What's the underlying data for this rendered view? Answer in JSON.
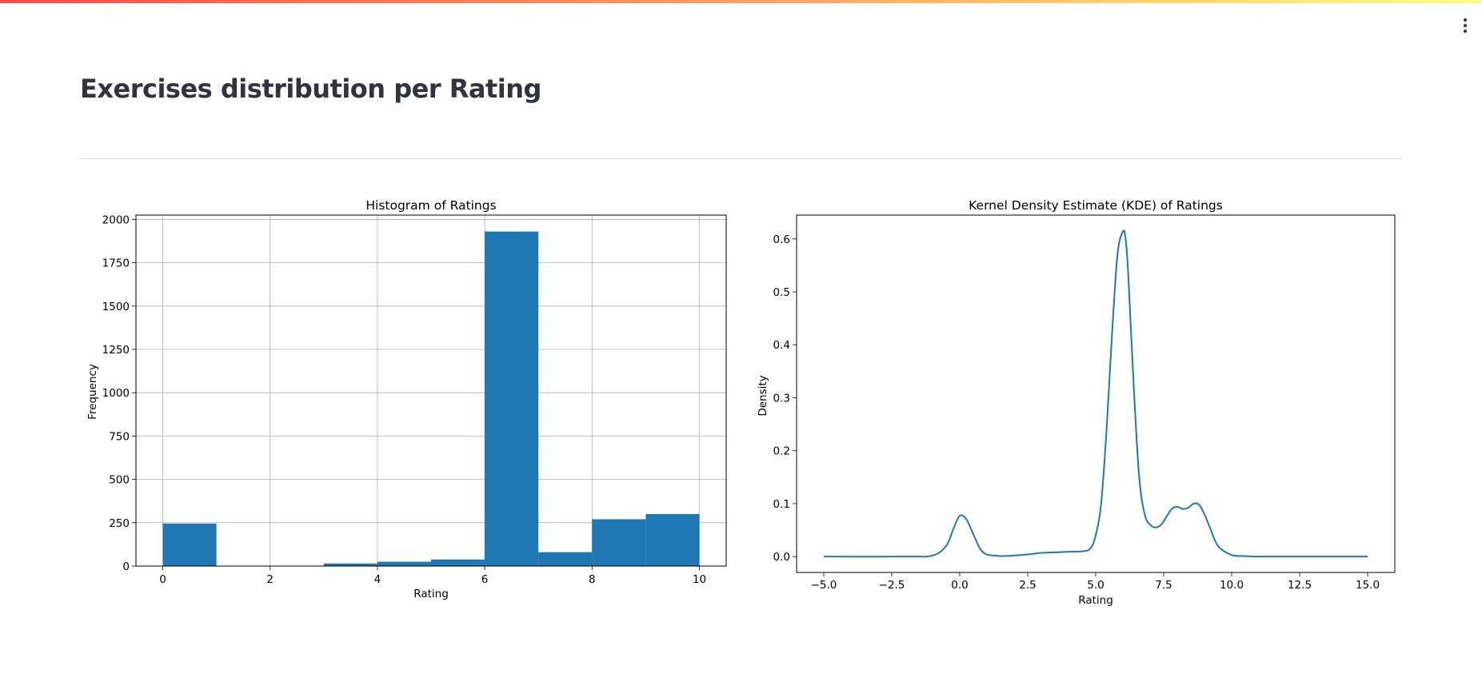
{
  "page": {
    "title": "Exercises distribution per Rating",
    "menu_icon": "vertical-ellipsis-icon",
    "colors": {
      "accent_gradient": [
        "#ff4b4b",
        "#ff9e66",
        "#fffd80"
      ],
      "title": "#31333f",
      "bar": "#1f77b4",
      "line": "#1f77b4"
    }
  },
  "chart_data": [
    {
      "type": "bar",
      "title": "Histogram of Ratings",
      "xlabel": "Rating",
      "ylabel": "Frequency",
      "grid": true,
      "bin_edges": [
        0,
        1,
        2,
        3,
        4,
        5,
        6,
        7,
        8,
        9,
        10
      ],
      "values": [
        245,
        0,
        0,
        15,
        25,
        38,
        1930,
        80,
        270,
        300
      ],
      "xlim": [
        -0.5,
        10.5
      ],
      "ylim": [
        0,
        2025
      ],
      "xticks": [
        "0",
        "2",
        "4",
        "6",
        "8",
        "10"
      ],
      "yticks": [
        "0",
        "250",
        "500",
        "750",
        "1000",
        "1250",
        "1500",
        "1750",
        "2000"
      ]
    },
    {
      "type": "line",
      "title": "Kernel Density Estimate (KDE) of Ratings",
      "xlabel": "Rating",
      "ylabel": "Density",
      "grid": false,
      "x": [
        -5.0,
        -2.0,
        -1.0,
        -0.5,
        -0.25,
        0.0,
        0.25,
        0.5,
        0.75,
        1.0,
        1.5,
        2.0,
        2.5,
        3.0,
        3.5,
        4.0,
        4.5,
        4.8,
        5.0,
        5.2,
        5.4,
        5.6,
        5.8,
        6.0,
        6.1,
        6.2,
        6.4,
        6.6,
        6.8,
        7.0,
        7.2,
        7.4,
        7.6,
        7.8,
        8.0,
        8.2,
        8.4,
        8.6,
        8.8,
        9.0,
        9.2,
        9.5,
        10.0,
        10.5,
        11.0,
        12.5,
        15.0
      ],
      "y": [
        0.0,
        0.0,
        0.002,
        0.02,
        0.05,
        0.077,
        0.07,
        0.042,
        0.015,
        0.004,
        0.001,
        0.002,
        0.004,
        0.007,
        0.008,
        0.009,
        0.01,
        0.015,
        0.04,
        0.1,
        0.24,
        0.42,
        0.57,
        0.614,
        0.6,
        0.53,
        0.32,
        0.15,
        0.08,
        0.06,
        0.055,
        0.06,
        0.075,
        0.09,
        0.094,
        0.09,
        0.092,
        0.1,
        0.098,
        0.08,
        0.055,
        0.02,
        0.003,
        0.001,
        0.0,
        0.0,
        0.0
      ],
      "xlim": [
        -6.0,
        16.0
      ],
      "ylim": [
        -0.03,
        0.645
      ],
      "xticks": [
        "−5.0",
        "−2.5",
        "0.0",
        "2.5",
        "5.0",
        "7.5",
        "10.0",
        "12.5",
        "15.0"
      ],
      "yticks": [
        "0.0",
        "0.1",
        "0.2",
        "0.3",
        "0.4",
        "0.5",
        "0.6"
      ]
    }
  ]
}
